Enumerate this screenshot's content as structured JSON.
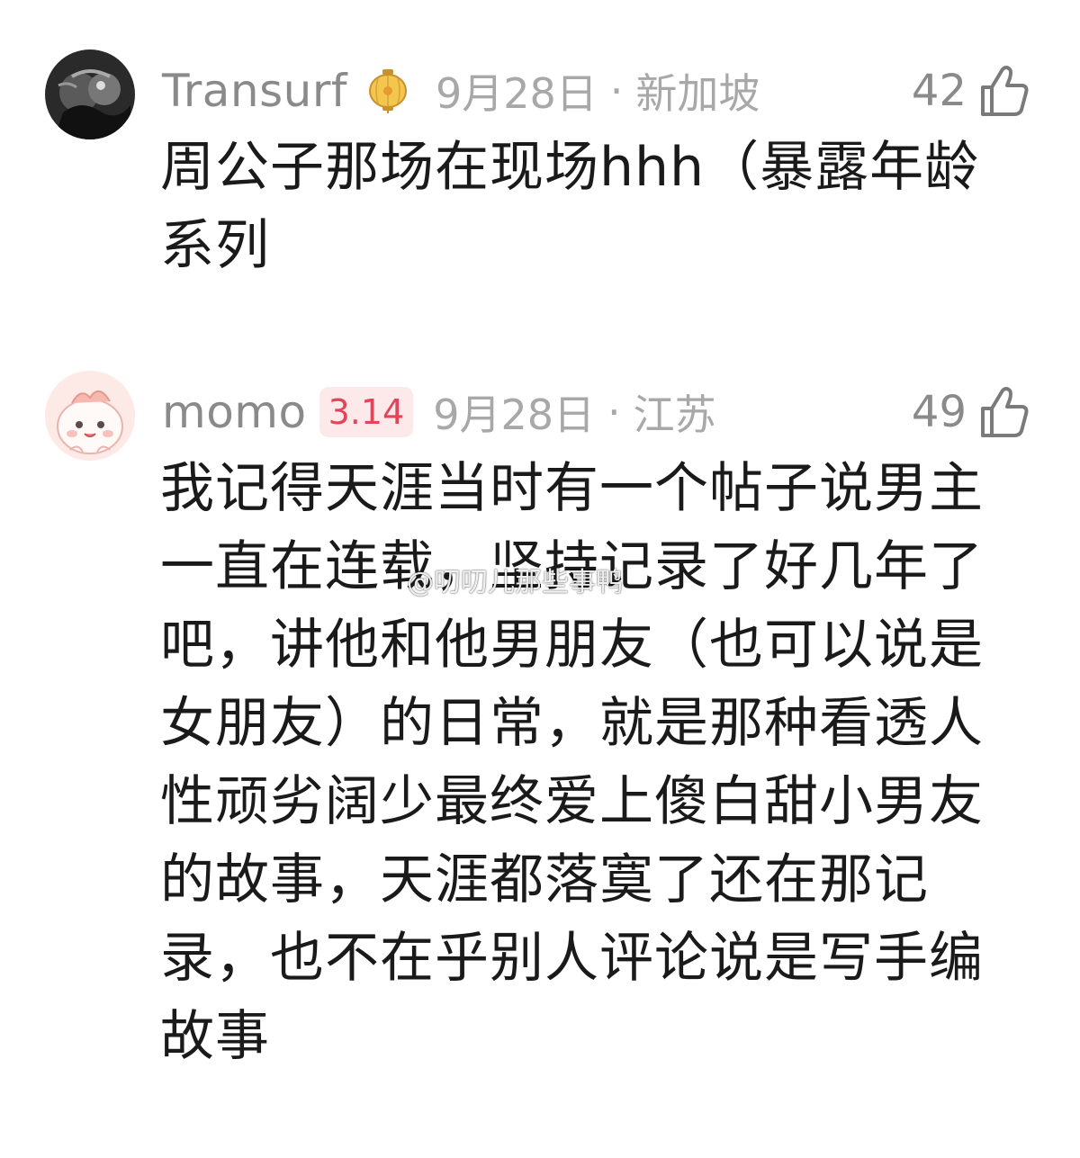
{
  "comments": [
    {
      "username": "Transurf",
      "badge_icon": "lantern-icon",
      "date": "9月28日",
      "location": "新加坡",
      "likes": "42",
      "text": "周公子那场在现场hhh（暴露年龄系列"
    },
    {
      "username": "momo",
      "level_badge": "3.14",
      "date": "9月28日",
      "location": "江苏",
      "likes": "49",
      "text": "我记得天涯当时有一个帖子说男主一直在连载，坚持记录了好几年了吧，讲他和他男朋友（也可以说是女朋友）的日常，就是那种看透人性顽劣阔少最终爱上傻白甜小男友的故事，天涯都落寞了还在那记录，也不在乎别人评论说是写手编故事"
    }
  ],
  "meta_separator": "·",
  "watermark": "@叨叨儿那些事鸭",
  "colors": {
    "username": "#8a8a8a",
    "meta": "#a8a8a8",
    "body_text": "#1a1a1a",
    "level_badge_bg": "#fde8ea",
    "level_badge_fg": "#e0455a"
  }
}
